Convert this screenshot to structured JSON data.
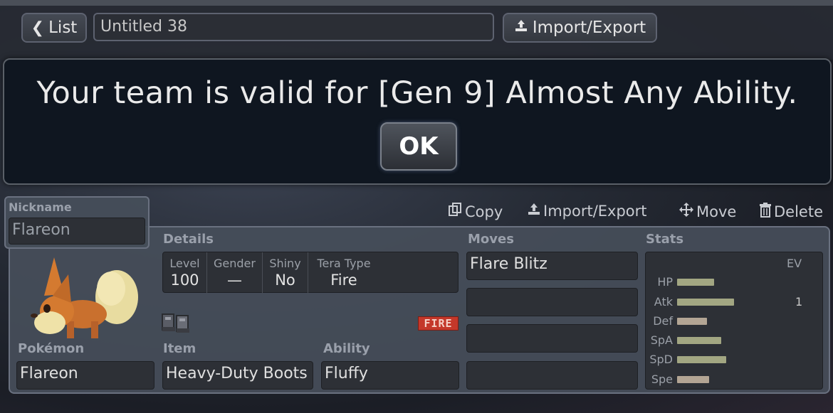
{
  "topbar": {
    "back_label": "List",
    "team_name": "Untitled 38",
    "import_export_label": "Import/Export"
  },
  "dialog": {
    "message": "Your team is valid for [Gen 9] Almost Any Ability.",
    "ok_label": "OK"
  },
  "set": {
    "nickname_label": "Nickname",
    "nickname_value": "Flareon",
    "actions": {
      "copy": "Copy",
      "import_export": "Import/Export",
      "move": "Move",
      "delete": "Delete"
    },
    "details_label": "Details",
    "details": [
      {
        "label": "Level",
        "value": "100"
      },
      {
        "label": "Gender",
        "value": "—"
      },
      {
        "label": "Shiny",
        "value": "No"
      },
      {
        "label": "Tera Type",
        "value": "Fire"
      }
    ],
    "tera_badge": "FIRE",
    "pokemon_label": "Pokémon",
    "pokemon_value": "Flareon",
    "item_label": "Item",
    "item_value": "Heavy-Duty Boots",
    "ability_label": "Ability",
    "ability_value": "Fluffy",
    "moves_label": "Moves",
    "moves": [
      "Flare Blitz",
      "",
      "",
      ""
    ],
    "stats_label": "Stats",
    "ev_header": "EV",
    "stats": [
      {
        "name": "HP",
        "ev": "",
        "color": "#a2a682"
      },
      {
        "name": "Atk",
        "ev": "1",
        "color": "#a2a682"
      },
      {
        "name": "Def",
        "ev": "",
        "color": "#b3a594"
      },
      {
        "name": "SpA",
        "ev": "",
        "color": "#a2a682"
      },
      {
        "name": "SpD",
        "ev": "",
        "color": "#a2a682"
      },
      {
        "name": "Spe",
        "ev": "",
        "color": "#b3a594"
      }
    ]
  }
}
